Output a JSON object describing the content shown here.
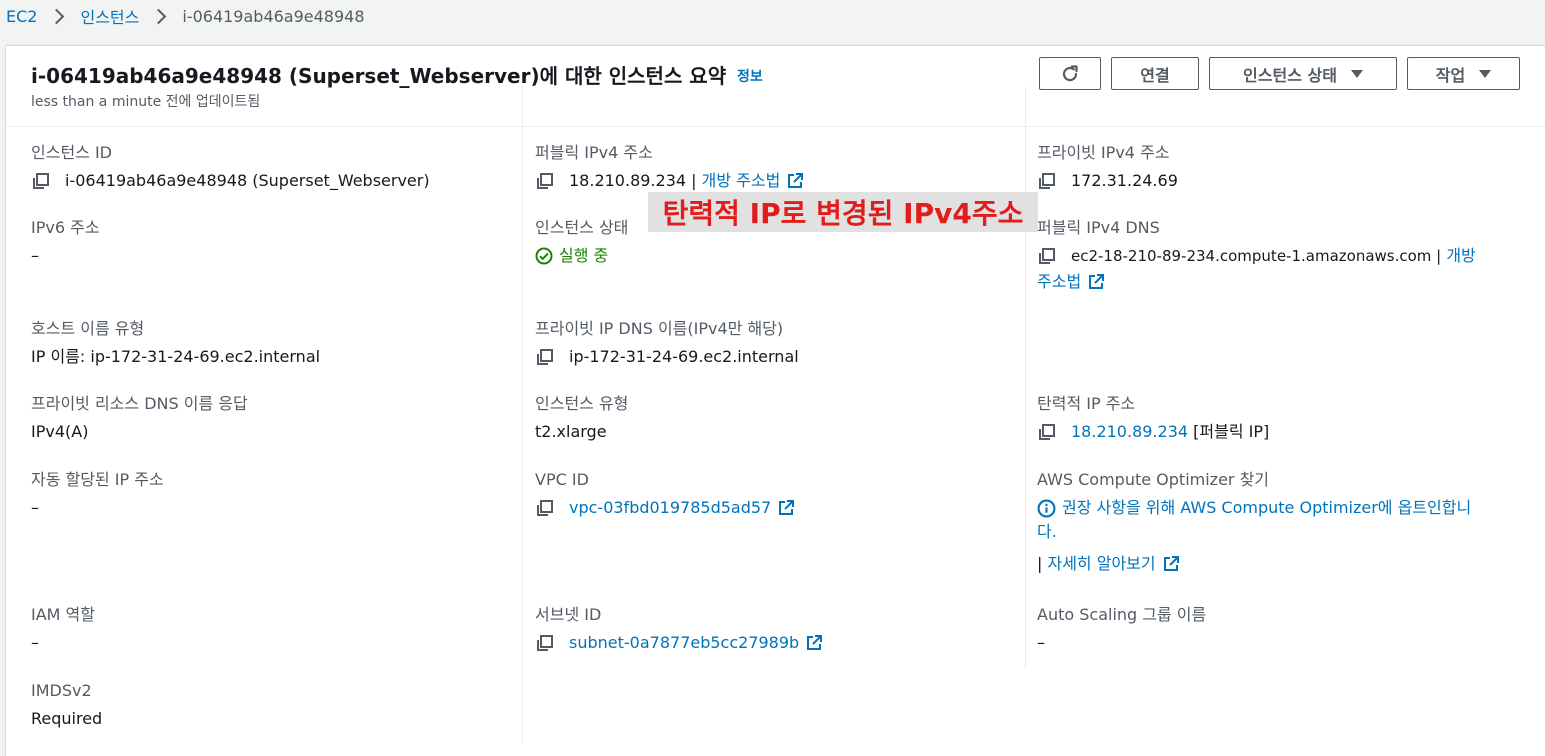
{
  "breadcrumb": {
    "root": "EC2",
    "section": "인스턴스",
    "current": "i-06419ab46a9e48948"
  },
  "header": {
    "title": "i-06419ab46a9e48948 (Superset_Webserver)에 대한 인스턴스 요약",
    "info": "정보",
    "subtitle": "less than a minute 전에 업데이트됨",
    "connect": "연결",
    "instance_state": "인스턴스 상태",
    "actions": "작업"
  },
  "fields": {
    "instance_id": {
      "label": "인스턴스 ID",
      "value": "i-06419ab46a9e48948 (Superset_Webserver)"
    },
    "ipv6": {
      "label": "IPv6 주소",
      "value": "–"
    },
    "hostname_type": {
      "label": "호스트 이름 유형",
      "value": "IP 이름: ip-172-31-24-69.ec2.internal"
    },
    "private_resource_dns": {
      "label": "프라이빗 리소스 DNS 이름 응답",
      "value": "IPv4(A)"
    },
    "auto_assigned_ip": {
      "label": "자동 할당된 IP 주소",
      "value": "–"
    },
    "iam_role": {
      "label": "IAM 역할",
      "value": "–"
    },
    "imdsv2": {
      "label": "IMDSv2",
      "value": "Required"
    },
    "public_ipv4": {
      "label": "퍼블릭 IPv4 주소",
      "value": "18.210.89.234 |",
      "link": "개방 주소법"
    },
    "instance_state": {
      "label": "인스턴스 상태",
      "value": "실행 중"
    },
    "private_ip_dns": {
      "label": "프라이빗 IP DNS 이름(IPv4만 해당)",
      "value": "ip-172-31-24-69.ec2.internal"
    },
    "instance_type": {
      "label": "인스턴스 유형",
      "value": "t2.xlarge"
    },
    "vpc_id": {
      "label": "VPC ID",
      "value": "vpc-03fbd019785d5ad57"
    },
    "subnet_id": {
      "label": "서브넷 ID",
      "value": "subnet-0a7877eb5cc27989b"
    },
    "private_ipv4": {
      "label": "프라이빗 IPv4 주소",
      "value": "172.31.24.69"
    },
    "public_dns": {
      "label": "퍼블릭 IPv4 DNS",
      "value": "ec2-18-210-89-234.compute-1.amazonaws.com |",
      "link_a": "개방",
      "link_b": "주소법"
    },
    "elastic_ip": {
      "label": "탄력적 IP 주소",
      "value": "18.210.89.234",
      "suffix": "[퍼블릭 IP]"
    },
    "compute_optimizer": {
      "label": "AWS Compute Optimizer 찾기",
      "line1": "권장 사항을 위해 AWS Compute Optimizer에 옵트인합니",
      "line2": "다.",
      "learn_more_bar": "|",
      "learn_more": "자세히 알아보기"
    },
    "auto_scaling": {
      "label": "Auto Scaling 그룹 이름",
      "value": "–"
    }
  },
  "annotation": "탄력적 IP로 변경된 IPv4주소",
  "colors": {
    "link": "#0073bb",
    "success": "#1d8102",
    "annotation": "#e21b1b"
  }
}
